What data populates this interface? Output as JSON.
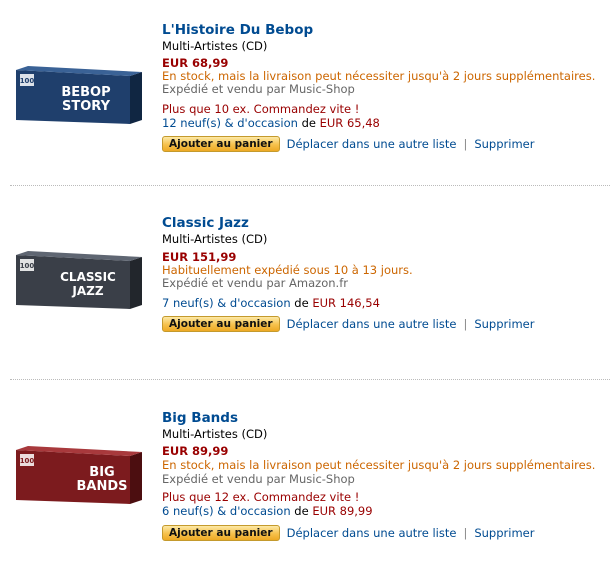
{
  "items": [
    {
      "title": "L'Histoire Du Bebop",
      "artist": "Multi-Artistes (CD)",
      "price": "EUR 68,99",
      "availability": "En stock, mais la livraison peut nécessiter jusqu'à 2 jours supplémentaires.",
      "shipper": "Expédié et vendu par Music-Shop",
      "stock_notice": "Plus que 10 ex. Commandez vite !",
      "offers_link": "12 neuf(s) & d'occasion",
      "offers_from": "de",
      "offers_price": "EUR 65,48",
      "cover": {
        "brand": "100",
        "line1": "BEBOP",
        "line2": "STORY",
        "color": "#1f3f6c"
      }
    },
    {
      "title": "Classic Jazz",
      "artist": "Multi-Artistes (CD)",
      "price": "EUR 151,99",
      "availability": "Habituellement expédié sous 10 à 13 jours.",
      "shipper": "Expédié et vendu par Amazon.fr",
      "stock_notice": "",
      "offers_link": "7 neuf(s) & d'occasion",
      "offers_from": "de",
      "offers_price": "EUR 146,54",
      "cover": {
        "brand": "100",
        "line1": "CLASSIC",
        "line2": "JAZZ",
        "color": "#3a3f48"
      }
    },
    {
      "title": "Big Bands",
      "artist": "Multi-Artistes (CD)",
      "price": "EUR 89,99",
      "availability": "En stock, mais la livraison peut nécessiter jusqu'à 2 jours supplémentaires.",
      "shipper": "Expédié et vendu par Music-Shop",
      "stock_notice": "Plus que 12 ex. Commandez vite !",
      "offers_link": "6 neuf(s) & d'occasion",
      "offers_from": "de",
      "offers_price": "EUR 89,99",
      "cover": {
        "brand": "100",
        "line1": "BIG",
        "line2": "BANDS",
        "color": "#7c1b1e"
      }
    }
  ],
  "actions": {
    "add_to_cart": "Ajouter au panier",
    "move": "Déplacer dans une autre liste",
    "separator": "|",
    "delete": "Supprimer"
  },
  "colors": {
    "link": "#004b91",
    "price": "#990000",
    "availability": "#cc6600",
    "button": "#f6c14b"
  }
}
